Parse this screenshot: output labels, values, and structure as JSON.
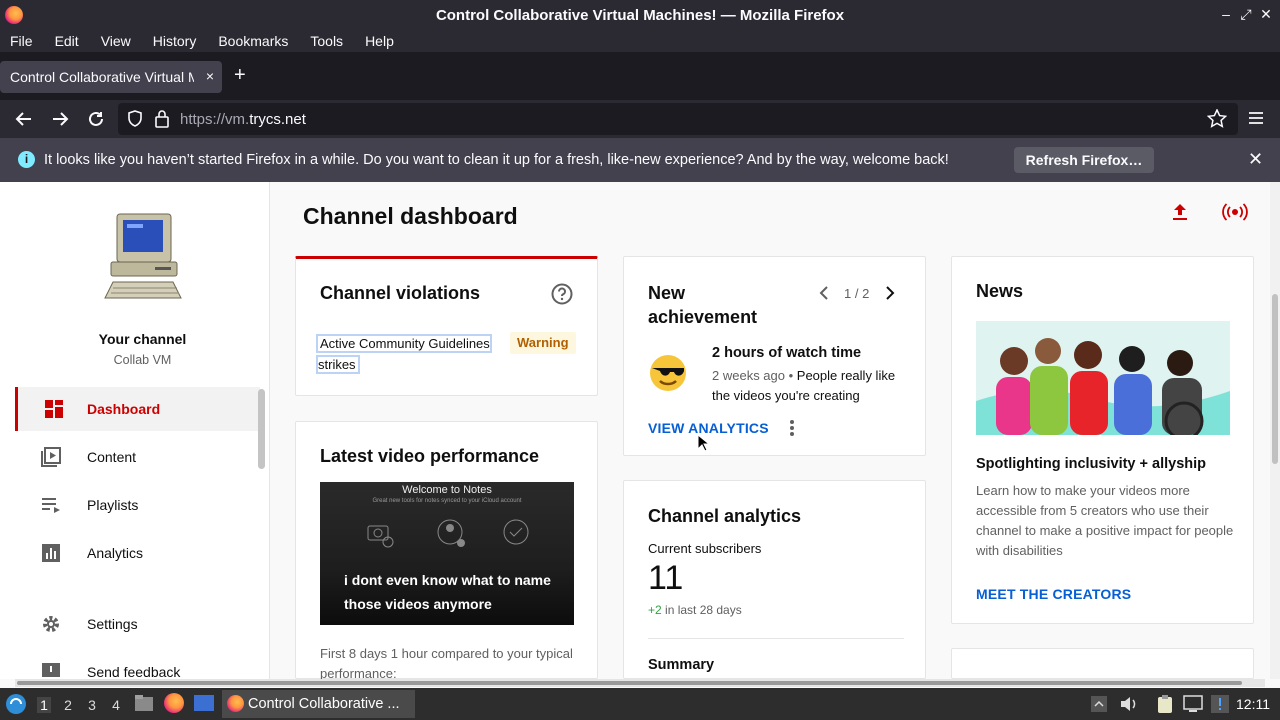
{
  "window": {
    "title": "Control Collaborative Virtual Machines! — Mozilla Firefox"
  },
  "menu": [
    "File",
    "Edit",
    "View",
    "History",
    "Bookmarks",
    "Tools",
    "Help"
  ],
  "tab": {
    "title": "Control Collaborative Virtual Machines!",
    "close": "×",
    "new": "+"
  },
  "url": {
    "scheme": "https://vm.",
    "host": "trycs.net"
  },
  "notification": {
    "text": "It looks like you haven’t started Firefox in a while. Do you want to clean it up for a fresh, like-new experience? And by the way, welcome back!",
    "button": "Refresh Firefox…",
    "icon": "i"
  },
  "sidebar": {
    "channel_label": "Your channel",
    "channel_name": "Collab VM",
    "items": [
      {
        "label": "Dashboard",
        "icon": "dashboard-icon"
      },
      {
        "label": "Content",
        "icon": "content-icon"
      },
      {
        "label": "Playlists",
        "icon": "playlists-icon"
      },
      {
        "label": "Analytics",
        "icon": "analytics-icon"
      },
      {
        "label": "Settings",
        "icon": "gear-icon"
      },
      {
        "label": "Send feedback",
        "icon": "feedback-icon"
      }
    ]
  },
  "main": {
    "title": "Channel dashboard",
    "violations": {
      "title": "Channel violations",
      "strike_label": "Active Community Guidelines strikes",
      "status": "Warning"
    },
    "latest": {
      "title": "Latest video performance",
      "thumb_header": "Welcome to Notes",
      "thumb_sub": "Great new tools for notes synced to your iCloud account",
      "caption": "i dont even know what to name those videos anymore",
      "footer": "First 8 days 1 hour compared to your typical performance:"
    },
    "achievement": {
      "title": "New achievement",
      "pager": "1 / 2",
      "headline": "2 hours of watch time",
      "time": "2 weeks ago",
      "separator": " • ",
      "desc": "People really like the videos you're creating",
      "link": "VIEW ANALYTICS",
      "emoji": "😎"
    },
    "analytics": {
      "title": "Channel analytics",
      "sub_label": "Current subscribers",
      "sub_count": "11",
      "delta": "+2",
      "delta_suffix": " in last 28 days",
      "summary": "Summary"
    },
    "news": {
      "title": "News",
      "headline": "Spotlighting inclusivity + allyship",
      "body": "Learn how to make your videos more accessible from 5 creators who use their channel to make a positive impact for people with disabilities",
      "link": "MEET THE CREATORS"
    }
  },
  "taskbar": {
    "workspaces": [
      "1",
      "2",
      "3",
      "4"
    ],
    "task": "Control Collaborative ...",
    "clock": "12:11"
  },
  "colors": {
    "accent_red": "#cc0000",
    "link_blue": "#065fd4",
    "warning_bg": "#fef7e0",
    "warning_text": "#b06000"
  }
}
